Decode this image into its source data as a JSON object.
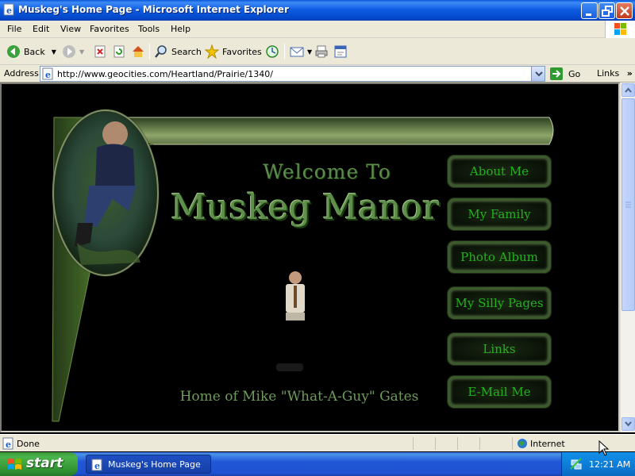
{
  "window": {
    "title": "Muskeg's Home Page - Microsoft Internet Explorer"
  },
  "menu": [
    "File",
    "Edit",
    "View",
    "Favorites",
    "Tools",
    "Help"
  ],
  "toolbar": {
    "back": "Back",
    "search": "Search",
    "favorites": "Favorites"
  },
  "address": {
    "label": "Address",
    "url": "http://www.geocities.com/Heartland/Prairie/1340/",
    "go": "Go",
    "links": "Links"
  },
  "page": {
    "welcome": "Welcome To",
    "title": "Muskeg Manor",
    "subtitle": "Home of Mike \"What-A-Guy\" Gates",
    "nav": [
      "About Me",
      "My Family",
      "Photo Album",
      "My Silly Pages",
      "Links",
      "E-Mail Me"
    ]
  },
  "status": {
    "text": "Done",
    "zone": "Internet"
  },
  "taskbar": {
    "start": "start",
    "task": "Muskeg's Home Page ...",
    "clock": "12:21 AM"
  },
  "colors": {
    "nav_text": "#23b11e",
    "title_green": "#5d8f4b",
    "xp_blue": "#0b5ae0"
  }
}
